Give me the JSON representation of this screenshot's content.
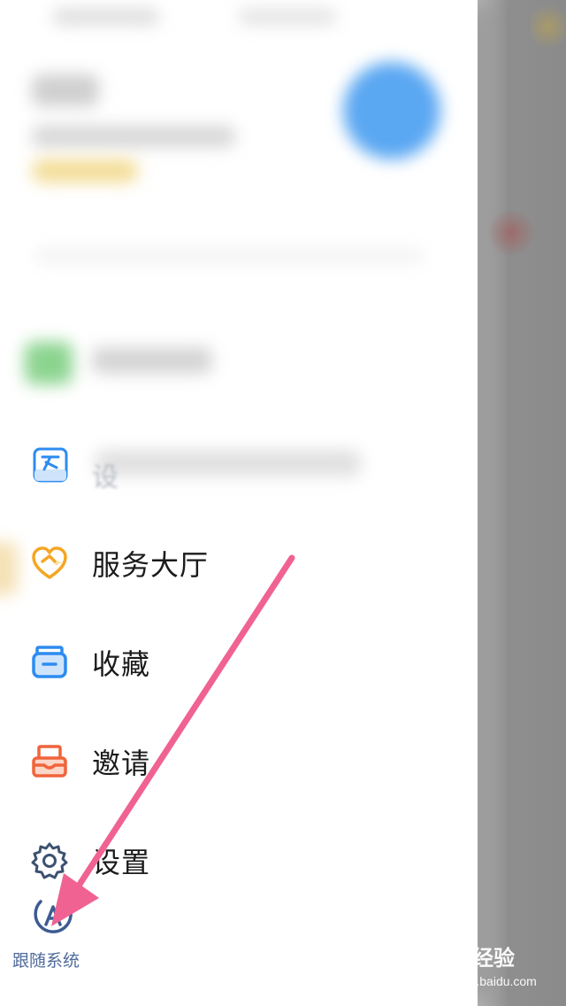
{
  "drawer": {
    "menu": [
      {
        "label": "服务大厅",
        "icon": "heart-service-icon",
        "color": "#F5A623"
      },
      {
        "label": "收藏",
        "icon": "folder-icon",
        "color": "#2D8CF0"
      },
      {
        "label": "邀请",
        "icon": "inbox-invite-icon",
        "color": "#F0643C"
      },
      {
        "label": "设置",
        "icon": "gear-icon",
        "color": "#3D5170"
      }
    ],
    "partial_item": {
      "label": "设",
      "icon": "id-card-icon",
      "color": "#2D8CF0"
    },
    "follow_system": {
      "label": "跟随系统",
      "icon": "follow-system-icon",
      "color": "#3D5A92"
    }
  },
  "annotation": {
    "arrow_color": "#F06292"
  },
  "watermark": {
    "brand": "Bai 经验",
    "url": "jingyan.baidu.com"
  }
}
